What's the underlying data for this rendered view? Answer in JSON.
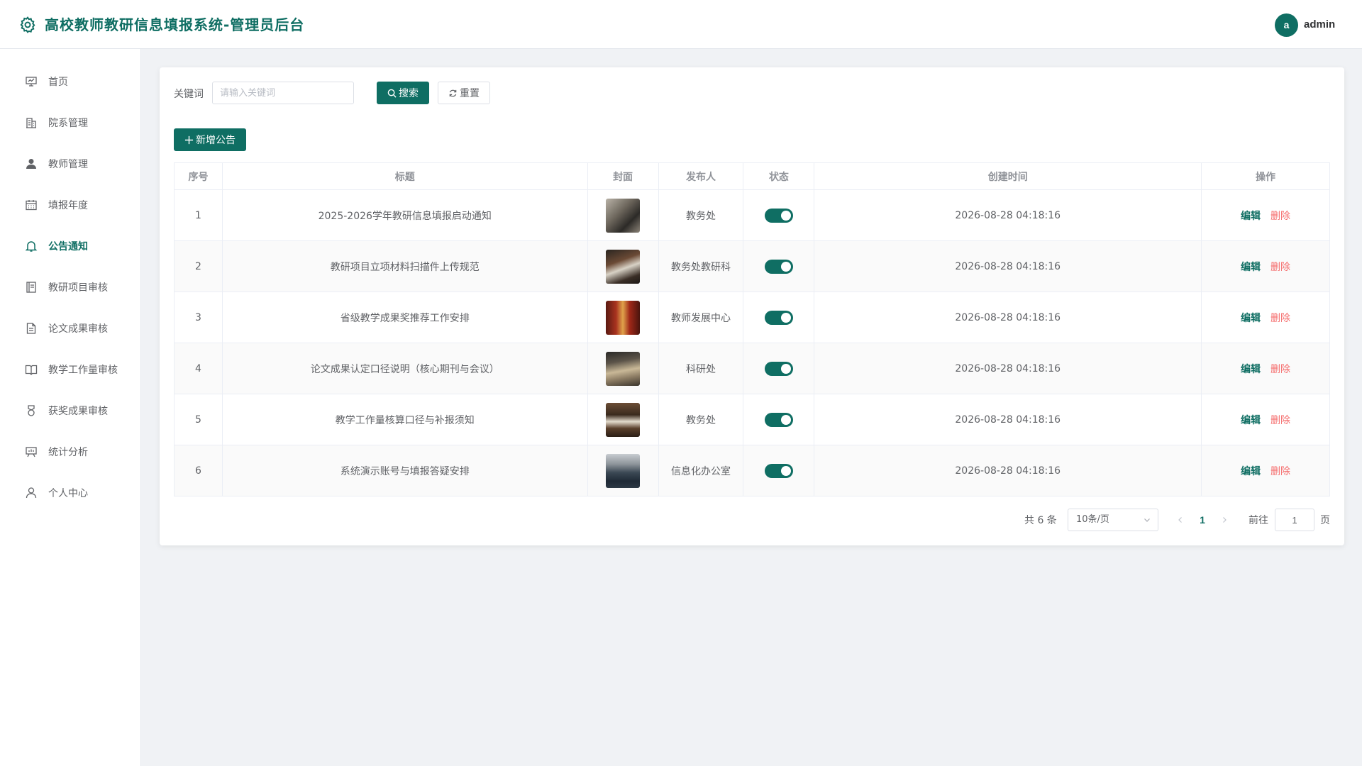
{
  "header": {
    "title": "高校教师教研信息填报系统-管理员后台",
    "avatar_letter": "a",
    "username": "admin"
  },
  "sidebar": {
    "items": [
      {
        "label": "首页",
        "icon": "presentation-icon"
      },
      {
        "label": "院系管理",
        "icon": "building-icon"
      },
      {
        "label": "教师管理",
        "icon": "user-filled-icon"
      },
      {
        "label": "填报年度",
        "icon": "calendar-icon"
      },
      {
        "label": "公告通知",
        "icon": "bell-icon",
        "active": true
      },
      {
        "label": "教研项目审核",
        "icon": "notebook-icon"
      },
      {
        "label": "论文成果审核",
        "icon": "document-icon"
      },
      {
        "label": "教学工作量审核",
        "icon": "book-open-icon"
      },
      {
        "label": "获奖成果审核",
        "icon": "medal-icon"
      },
      {
        "label": "统计分析",
        "icon": "data-board-icon"
      },
      {
        "label": "个人中心",
        "icon": "user-icon"
      }
    ]
  },
  "search": {
    "keyword_label": "关键词",
    "keyword_placeholder": "请输入关键词",
    "search_label": "搜索",
    "reset_label": "重置",
    "add_label": "新增公告"
  },
  "table": {
    "headers": [
      "序号",
      "标题",
      "封面",
      "发布人",
      "状态",
      "创建时间",
      "操作"
    ],
    "rows": [
      {
        "no": "1",
        "title": "2025-2026学年教研信息填报启动通知",
        "publisher": "教务处",
        "status": true,
        "created": "2026-08-28 04:18:16"
      },
      {
        "no": "2",
        "title": "教研项目立项材料扫描件上传规范",
        "publisher": "教务处教研科",
        "status": true,
        "created": "2026-08-28 04:18:16"
      },
      {
        "no": "3",
        "title": "省级教学成果奖推荐工作安排",
        "publisher": "教师发展中心",
        "status": true,
        "created": "2026-08-28 04:18:16"
      },
      {
        "no": "4",
        "title": "论文成果认定口径说明（核心期刊与会议）",
        "publisher": "科研处",
        "status": true,
        "created": "2026-08-28 04:18:16"
      },
      {
        "no": "5",
        "title": "教学工作量核算口径与补报须知",
        "publisher": "教务处",
        "status": true,
        "created": "2026-08-28 04:18:16"
      },
      {
        "no": "6",
        "title": "系统演示账号与填报答疑安排",
        "publisher": "信息化办公室",
        "status": true,
        "created": "2026-08-28 04:18:16"
      }
    ],
    "edit_label": "编辑",
    "delete_label": "删除"
  },
  "pagination": {
    "total": "共 6 条",
    "page_size": "10条/页",
    "current_page": "1",
    "goto_label": "前往",
    "goto_value": "1",
    "page_suffix": "页"
  },
  "colors": {
    "primary": "#0f6e63",
    "danger": "#f56c6c"
  }
}
